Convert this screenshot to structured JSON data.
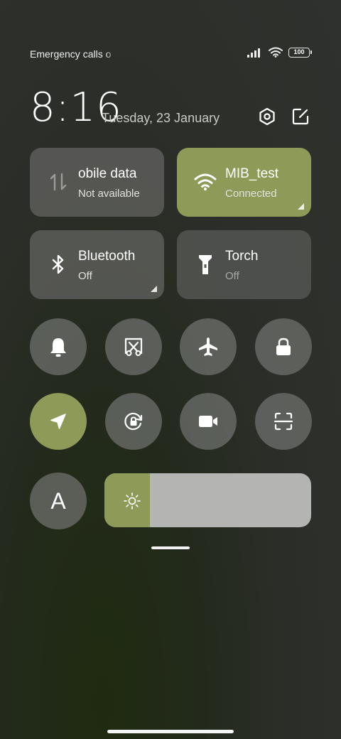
{
  "status_bar": {
    "carrier": "Emergency calls o",
    "battery": "100"
  },
  "header": {
    "time": "8:16",
    "date": "Tuesday, 23 January"
  },
  "tiles": [
    {
      "name": "obile data",
      "status": "Not available",
      "state": "inactive",
      "icon": "mobile-data-icon"
    },
    {
      "name": "MIB_test",
      "status": "Connected",
      "state": "active",
      "icon": "wifi-icon"
    },
    {
      "name": "Bluetooth",
      "status": "Off",
      "state": "inactive",
      "icon": "bluetooth-icon"
    },
    {
      "name": "Torch",
      "status": "Off",
      "state": "inactive",
      "icon": "torch-icon"
    }
  ],
  "toggles_row1": [
    "bell-icon",
    "screenshot-icon",
    "airplane-icon",
    "lock-icon"
  ],
  "toggles_row2": [
    "location-icon",
    "rotation-lock-icon",
    "video-icon",
    "scanner-icon"
  ],
  "auto_brightness_label": "A",
  "brightness": {
    "level": 0.22
  },
  "colors": {
    "accent": "#8d9a58",
    "tile": "#6f716d",
    "slider_track": "#b4b4b2"
  }
}
